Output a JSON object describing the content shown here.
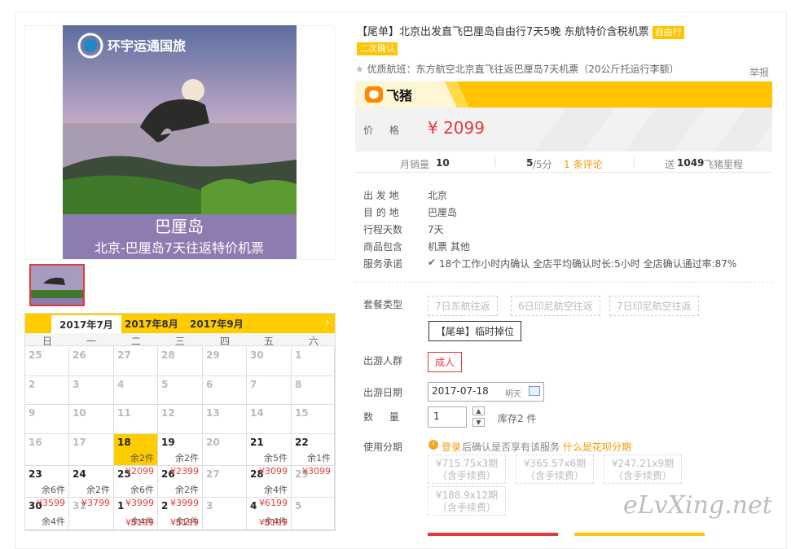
{
  "product": {
    "title": "【尾单】北京出发直飞巴厘岛自由行7天5晚 东航特价含税机票",
    "tag_free": "自由行",
    "tag_confirm": "二次确认",
    "subtitle": "优质航班：东方航空北京直飞往返巴厘岛7天机票（20公斤托运行李额）",
    "report": "举报",
    "brand": "飞猪",
    "price_label": "价  格",
    "price": "¥ 2099"
  },
  "image": {
    "logo_text": "环宇运通国旅",
    "caption_1": "巴厘岛",
    "caption_2": "北京-巴厘岛7天往返特价机票"
  },
  "stats": {
    "sales_label": "月销量",
    "sales": "10",
    "rating": "5",
    "rating_suffix": "/5分",
    "reviews": "1 条评论",
    "miles_prefix": "送",
    "miles": "1049",
    "miles_suffix": "飞猪里程"
  },
  "info": [
    {
      "k": "出 发 地",
      "v": "北京"
    },
    {
      "k": "目 的 地",
      "v": "巴厘岛"
    },
    {
      "k": "行程天数",
      "v": "7天"
    },
    {
      "k": "商品包含",
      "v": "机票  其他"
    },
    {
      "k": "服务承诺",
      "v": "18个工作小时内确认    全店平均确认时长:5小时    全店确认通过率:87%"
    }
  ],
  "options": {
    "package_label": "套餐类型",
    "packages": [
      "7日东航往返",
      "6日印尼航空往返",
      "7日印尼航空往返",
      "【尾单】临时掉位"
    ],
    "people_label": "出游人群",
    "people": "成人",
    "date_label": "出游日期",
    "date_value": "2017-07-18",
    "date_hint": "明天",
    "qty_label": "数  量",
    "qty_value": "1",
    "stock": "库存2 件",
    "inst_label": "使用分期",
    "inst_login": "登录",
    "inst_text": "后确认是否享有该服务",
    "inst_link": "什么是花呗分期",
    "installments": [
      {
        "line1": "¥715.75x3期",
        "line2": "（含手续费）"
      },
      {
        "line1": "¥365.57x6期",
        "line2": "（含手续费）"
      },
      {
        "line1": "¥247.21x9期",
        "line2": "（含手续费）"
      },
      {
        "line1": "¥188.9x12期",
        "line2": "（含手续费）"
      }
    ]
  },
  "calendar": {
    "months": [
      "2017年7月",
      "2017年8月",
      "2017年9月"
    ],
    "next": "›",
    "weekdays": [
      "日",
      "一",
      "二",
      "三",
      "四",
      "五",
      "六"
    ],
    "rows": [
      [
        {
          "d": "25",
          "s": "past"
        },
        {
          "d": "26",
          "s": "past"
        },
        {
          "d": "27",
          "s": "past"
        },
        {
          "d": "28",
          "s": "past"
        },
        {
          "d": "29",
          "s": "past"
        },
        {
          "d": "30",
          "s": "past"
        },
        {
          "d": "1",
          "s": "past"
        }
      ],
      [
        {
          "d": "2",
          "s": "past"
        },
        {
          "d": "3",
          "s": "past"
        },
        {
          "d": "4",
          "s": "past"
        },
        {
          "d": "5",
          "s": "past"
        },
        {
          "d": "6",
          "s": "past"
        },
        {
          "d": "7",
          "s": "past"
        },
        {
          "d": "8",
          "s": "past"
        }
      ],
      [
        {
          "d": "9",
          "s": "past"
        },
        {
          "d": "10",
          "s": "past"
        },
        {
          "d": "11",
          "s": "past"
        },
        {
          "d": "12",
          "s": "past"
        },
        {
          "d": "13",
          "s": "past"
        },
        {
          "d": "14",
          "s": "past"
        },
        {
          "d": "15",
          "s": "past"
        }
      ],
      [
        {
          "d": "16",
          "s": "past"
        },
        {
          "d": "17",
          "s": "past"
        },
        {
          "d": "18",
          "s": "sel",
          "stock": "余2件"
        },
        {
          "d": "19",
          "s": "avail",
          "stock": "余2件"
        },
        {
          "d": "20",
          "s": "past"
        },
        {
          "d": "21",
          "s": "avail",
          "stock": "余5件"
        },
        {
          "d": "22",
          "s": "avail",
          "stock": "余1件"
        }
      ],
      [
        {
          "d": "23",
          "s": "avail",
          "stock": "余6件"
        },
        {
          "d": "24",
          "s": "avail",
          "stock": "余2件"
        },
        {
          "d": "25",
          "s": "avail",
          "stock": "余6件",
          "price": "¥2099"
        },
        {
          "d": "26",
          "s": "avail",
          "stock": "余2件",
          "price": "¥2399"
        },
        {
          "d": "27",
          "s": "past"
        },
        {
          "d": "28",
          "s": "avail",
          "stock": "余4件",
          "price": "¥3099"
        },
        {
          "d": "29",
          "s": "past",
          "price": "¥3099"
        }
      ],
      [
        {
          "d": "30",
          "s": "avail",
          "stock": "余4件",
          "price": "¥3599"
        },
        {
          "d": "31",
          "s": "past",
          "price": "¥3799"
        },
        {
          "d": "1",
          "s": "avail",
          "stock": "余4件",
          "price": "¥3999",
          "priceb": "¥5199"
        },
        {
          "d": "2",
          "s": "avail",
          "stock": "余2件",
          "price": "¥3999",
          "priceb": "¥5199"
        },
        {
          "d": "3",
          "s": "past"
        },
        {
          "d": "4",
          "s": "avail",
          "stock": "余4件",
          "price": "¥6199",
          "priceb": "¥5199"
        },
        {
          "d": "5",
          "s": "past"
        }
      ]
    ]
  },
  "watermark": "eLvXing.net",
  "colors": {
    "accent": "#ffc300",
    "price": "#e4393c"
  }
}
